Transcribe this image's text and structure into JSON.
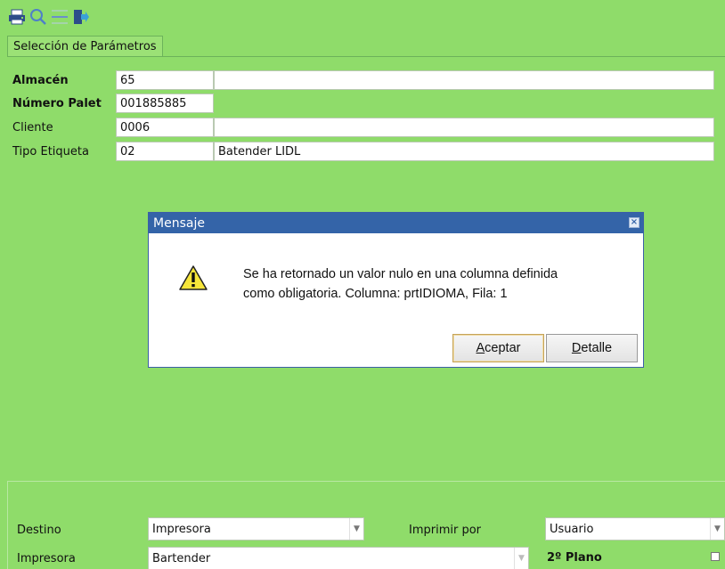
{
  "toolbar": {
    "icons": [
      "printer-icon",
      "search-icon",
      "separator-icon",
      "exit-icon"
    ]
  },
  "tab": {
    "label": "Selección de Parámetros"
  },
  "params": [
    {
      "label": "Almacén",
      "code": "65",
      "desc": "",
      "bold": true
    },
    {
      "label": "Número Palet",
      "code": "001885885",
      "desc": null,
      "bold": true
    },
    {
      "label": "Cliente",
      "code": "0006",
      "desc": "",
      "bold": false
    },
    {
      "label": "Tipo Etiqueta",
      "code": "02",
      "desc": "Batender LIDL",
      "bold": false
    }
  ],
  "dialog": {
    "title": "Mensaje",
    "message_line1": "Se ha retornado un valor nulo en una columna definida",
    "message_line2": "como obligatoria. Columna: prtIDIOMA, Fila: 1",
    "accept_prefix": "A",
    "accept_rest": "ceptar",
    "detail_prefix": "D",
    "detail_rest": "etalle"
  },
  "bottom": {
    "destino_label": "Destino",
    "destino_value": "Impresora",
    "imprimir_por_label": "Imprimir por",
    "imprimir_por_value": "Usuario",
    "impresora_label": "Impresora",
    "impresora_value": "Bartender",
    "segundo_plano_label": "2º Plano",
    "segundo_plano_checked": false
  },
  "colors": {
    "background": "#8fdc6a",
    "dialog_title": "#3464a8"
  }
}
